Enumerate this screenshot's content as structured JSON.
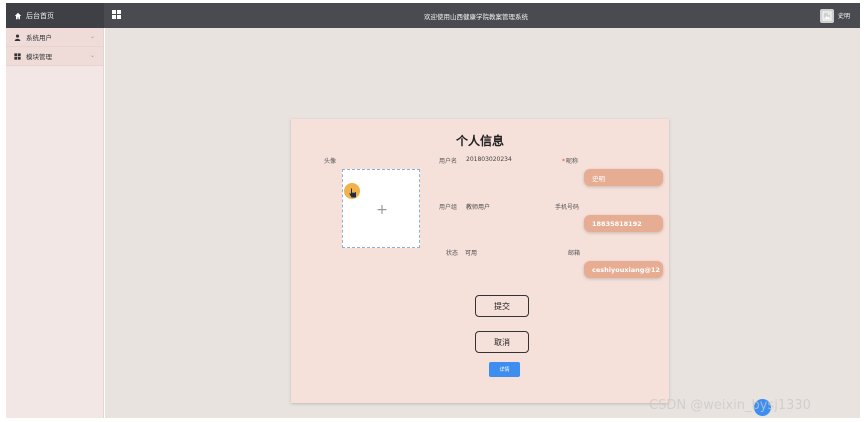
{
  "header": {
    "home_label": "后台首页",
    "site_title": "欢迎使用山西健康学院教案管理系统",
    "user_name": "史明"
  },
  "sidebar": {
    "items": [
      {
        "label": "系统用户",
        "icon": "user-icon"
      },
      {
        "label": "模块管理",
        "icon": "grid-icon"
      }
    ]
  },
  "profile": {
    "title": "个人信息",
    "avatar_label": "头像",
    "upload_plus": "+",
    "username_label": "用户名",
    "username_value": "201803020234",
    "usergroup_label": "用户组",
    "usergroup_value": "教师用户",
    "status_label": "状态",
    "status_value": "可用",
    "nickname_label": "昵称",
    "nickname_required": "*",
    "nickname_value": "史明",
    "phone_label": "手机号码",
    "phone_value": "18835818192",
    "email_label": "邮箱",
    "email_value": "ceshiyouxiang@12",
    "submit_label": "提交",
    "cancel_label": "取消",
    "detail_label": "详情"
  },
  "watermark": "CSDN @weixin_bysj1330",
  "colors": {
    "topbar": "#4a4b50",
    "sidebar": "#f3e7e6",
    "card": "#f5e0da",
    "field": "#e6ad93",
    "primary": "#3d8ef0"
  }
}
